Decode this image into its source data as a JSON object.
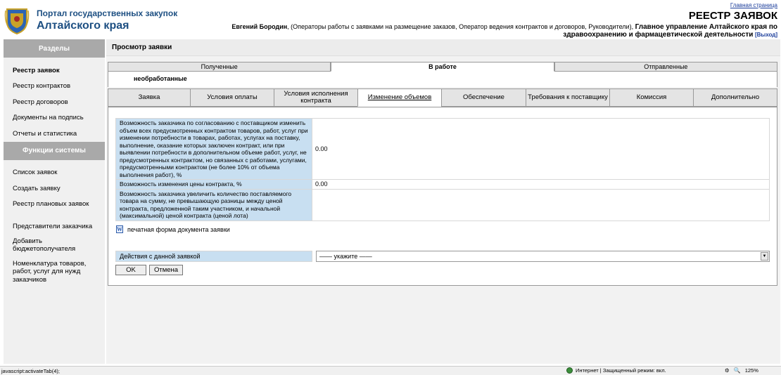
{
  "header": {
    "portal_line1": "Портал государственных закупок",
    "portal_line2": "Алтайского края",
    "home_link": "Главная страница",
    "registry_title": "РЕЕСТР ЗАЯВОК",
    "user_name": "Евгений Бородин",
    "user_roles": ", (Операторы работы с заявками на размещение заказов, Оператор ведения контрактов и договоров, Руководители),",
    "org_line1": "Главное управление Алтайского края по",
    "org_line2": "здравоохранению и фармацевтической деятельности",
    "exit_link": "[Выход]"
  },
  "sidebar": {
    "sections_header": "Разделы",
    "sections_items": [
      "Реестр заявок",
      "Реестр контрактов",
      "Реестр договоров",
      "Документы на подпись",
      "Отчеты и статистика"
    ],
    "functions_header": "Функции системы",
    "functions_items": [
      "Список заявок",
      "Создать заявку",
      "Реестр плановых заявок"
    ],
    "extra_items": [
      "Представители заказчика",
      "Добавить бюджетополучателя",
      "Номенклатура товаров, работ, услуг для нужд заказчиков"
    ]
  },
  "main": {
    "section_title": "Просмотр заявки",
    "status_tabs": [
      "Полученные",
      "В работе",
      "Отправленные"
    ],
    "subtab_label": "необработанные",
    "detail_tabs": [
      "Заявка",
      "Условия оплаты",
      "Условия исполнения контракта",
      "Изменение объемов",
      "Обеспечение",
      "Требования к поставщику",
      "Комиссия",
      "Дополнительно"
    ],
    "fields": [
      {
        "label": "Возможность заказчика по согласованию с поставщиком изменить объем всех предусмотренных контрактом товаров, работ, услуг при изменении потребности в товарах, работах, услугах на поставку, выполнение, оказание которых заключен контракт, или при выявлении потребности в дополнительном объеме работ, услуг, не предусмотренных контрактом, но связанных с работами, услугами, предусмотренными контрактом (не более 10% от объема выполнения работ), %",
        "value": "0.00"
      },
      {
        "label": "Возможность изменения цены контракта, %",
        "value": "0.00"
      },
      {
        "label": "Возможность заказчика увеличить количество поставляемого товара на сумму, не превышающую разницы между ценой контракта, предложенной таким участником, и начальной (максимальной) ценой контракта (ценой лота)",
        "value": ""
      }
    ],
    "print_icon": "W",
    "print_link": "печатная форма документа заявки",
    "actions_label": "Действия с данной заявкой",
    "actions_selected": "—— укажите ——",
    "ok_label": "OK",
    "cancel_label": "Отмена"
  },
  "statusbar": {
    "text": "javascript:activateTab(4);",
    "zone": "Интернет | Защищенный режим: вкл.",
    "zoom": "125%"
  }
}
